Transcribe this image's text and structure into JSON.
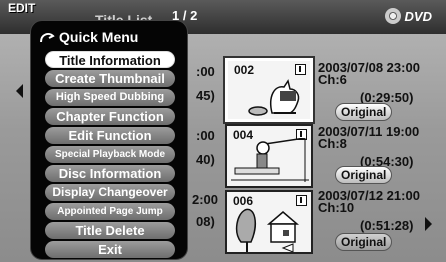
{
  "header": {
    "logo_text": "EDIT",
    "title": "Title List",
    "page": "1 / 2",
    "device": "DVD"
  },
  "quick_menu": {
    "title": "Quick Menu",
    "items": [
      {
        "label": "Title Information",
        "active": true
      },
      {
        "label": "Create Thumbnail"
      },
      {
        "label": "High Speed Dubbing"
      },
      {
        "label": "Chapter Function"
      },
      {
        "label": "Edit Function"
      },
      {
        "label": "Special Playback Mode"
      },
      {
        "label": "Disc Information"
      },
      {
        "label": "Display Changeover"
      },
      {
        "label": "Appointed Page Jump"
      },
      {
        "label": "Title Delete"
      },
      {
        "label": "Exit"
      }
    ]
  },
  "titles": [
    {
      "time_frag": ":00",
      "dur_frag": "45)",
      "number": "002",
      "datetime": "2003/07/08 23:00",
      "channel": "Ch:6",
      "duration": "(0:29:50)",
      "badge": "Original"
    },
    {
      "time_frag": ":00",
      "dur_frag": "40)",
      "number": "004",
      "datetime": "2003/07/11 19:00",
      "channel": "Ch:8",
      "duration": "(0:54:30)",
      "badge": "Original"
    },
    {
      "time_frag": "2:00",
      "dur_frag": "08)",
      "number": "006",
      "datetime": "2003/07/12 21:00",
      "channel": "Ch:10",
      "duration": "(0:51:28)",
      "badge": "Original"
    }
  ]
}
